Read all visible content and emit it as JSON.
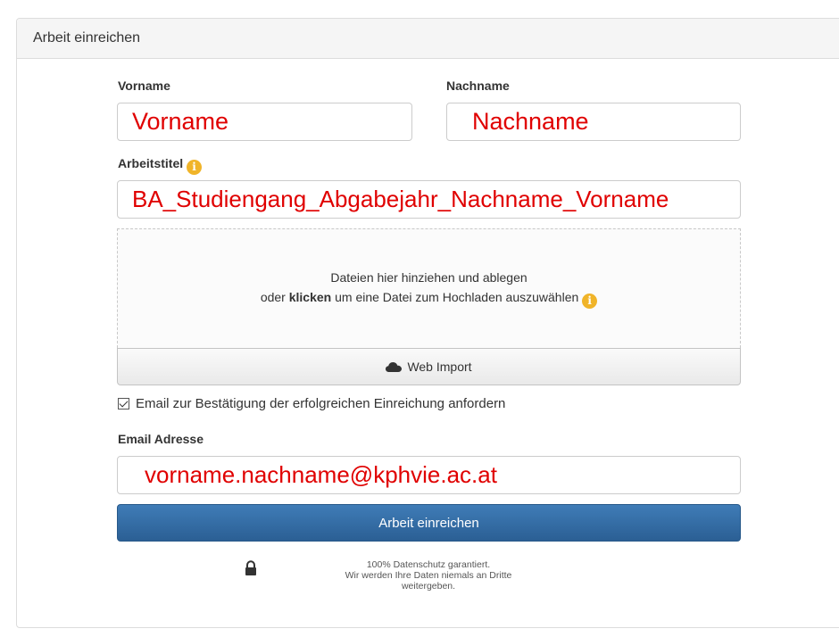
{
  "panel": {
    "title": "Arbeit einreichen"
  },
  "form": {
    "first_name_label": "Vorname",
    "first_name_value": "Vorname",
    "last_name_label": "Nachname",
    "last_name_value": "Nachname",
    "title_label": "Arbeitstitel",
    "title_value": "BA_Studiengang_Abgabejahr_Nachname_Vorname",
    "info_icon": "info-icon",
    "dropzone_line1": "Dateien hier hinziehen und ablegen",
    "dropzone_line2_prefix": "oder",
    "dropzone_line2_bold": "klicken",
    "dropzone_line2_suffix": "um eine Datei zum Hochladen auszuwählen",
    "web_import_label": "Web Import",
    "web_import_icon": "cloud-icon",
    "confirm_email_label": "Email zur Bestätigung der erfolgreichen Einreichung anfordern",
    "confirm_email_checked": true,
    "email_label": "Email Adresse",
    "email_value": "vorname.nachname@kphvie.ac.at",
    "submit_label": "Arbeit einreichen"
  },
  "privacy": {
    "icon": "lock-icon",
    "line1": "100% Datenschutz garantiert.",
    "line2": "Wir werden Ihre Daten niemals an Dritte",
    "line3": "weitergeben."
  },
  "colors": {
    "annotation_red": "#e00000",
    "submit_blue": "#2f6aa4",
    "info_yellow": "#f0b429"
  }
}
